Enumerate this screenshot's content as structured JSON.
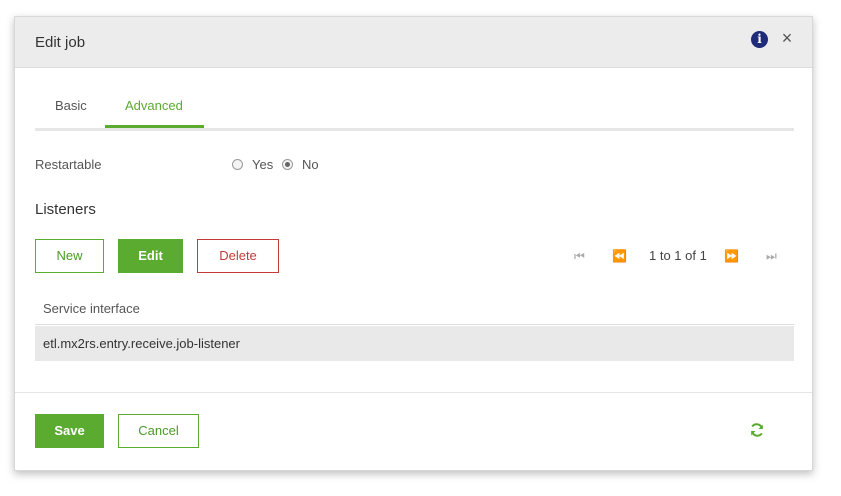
{
  "dialog": {
    "title": "Edit job",
    "info_icon": "info-icon",
    "close_icon": "close-icon",
    "close_glyph": "×",
    "info_glyph": "i"
  },
  "tabs": [
    {
      "label": "Basic",
      "active": false
    },
    {
      "label": "Advanced",
      "active": true
    }
  ],
  "restartable": {
    "label": "Restartable",
    "options": [
      "Yes",
      "No"
    ],
    "selected": "No"
  },
  "listeners": {
    "title": "Listeners",
    "buttons": {
      "new": "New",
      "edit": "Edit",
      "delete": "Delete"
    },
    "pager": {
      "text": "1 to 1 of 1",
      "first_glyph": "⏮",
      "prev_glyph": "⏪",
      "next_glyph": "⏩",
      "last_glyph": "⏭"
    },
    "table": {
      "columns": [
        "Service interface"
      ],
      "rows": [
        [
          "etl.mx2rs.entry.receive.job-listener"
        ]
      ]
    }
  },
  "footer": {
    "save_label": "Save",
    "cancel_label": "Cancel",
    "refresh_icon": "refresh-icon"
  },
  "colors": {
    "accent": "#5aab2f",
    "danger": "#c23b3b",
    "info": "#1f2a78"
  }
}
